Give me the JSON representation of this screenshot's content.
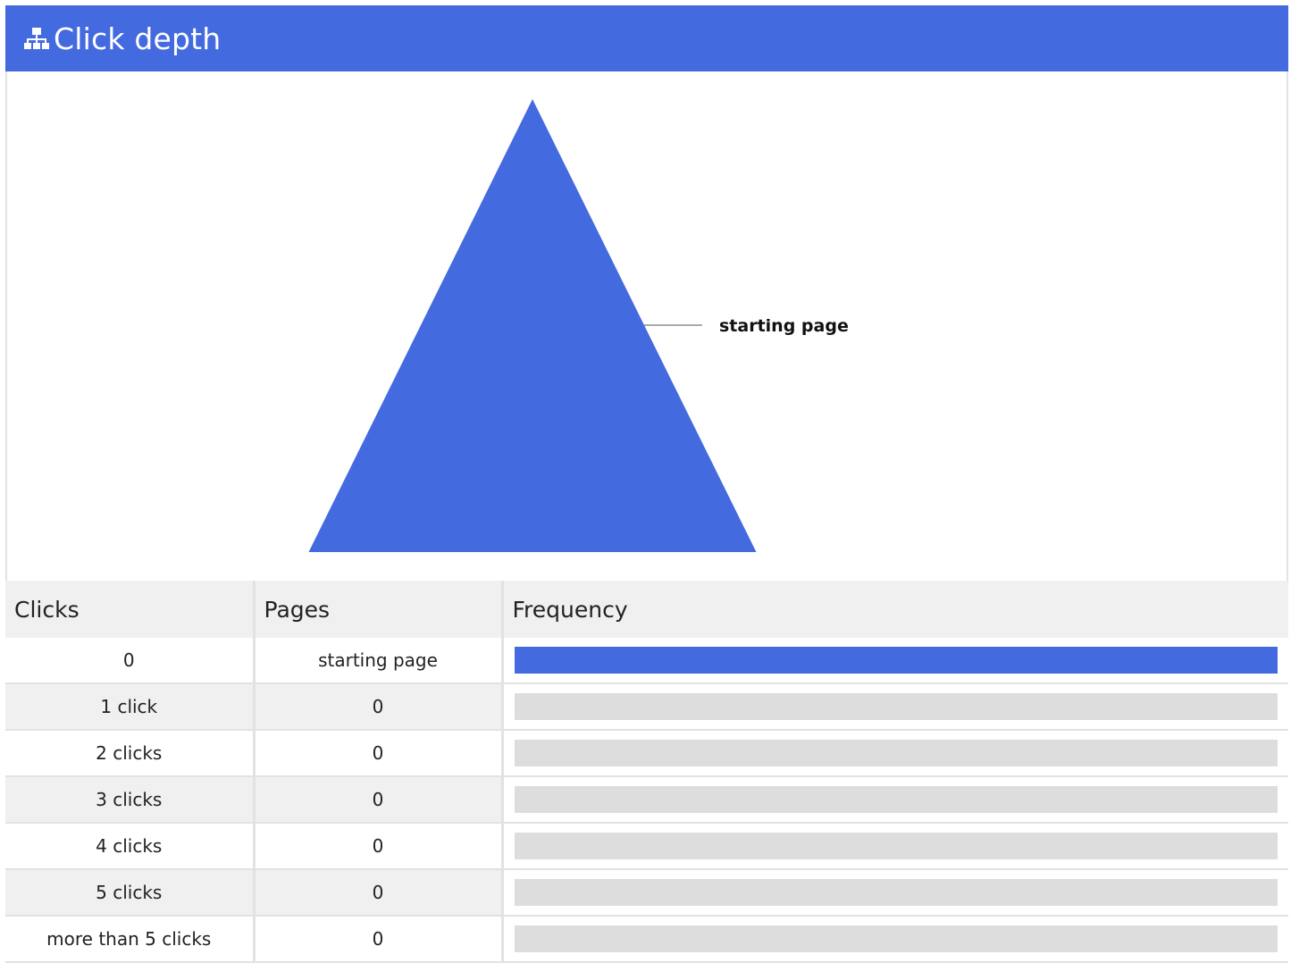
{
  "header": {
    "icon": "sitemap-icon",
    "title": "Click depth"
  },
  "colors": {
    "accent": "#446adf",
    "track": "#dddddd",
    "header_bg": "#f0f0f0"
  },
  "chart_data": {
    "type": "pyramid",
    "segments": [
      {
        "label": "starting page",
        "value": 1
      }
    ]
  },
  "table": {
    "columns": [
      "Clicks",
      "Pages",
      "Frequency"
    ],
    "rows": [
      {
        "clicks": "0",
        "pages": "starting page",
        "frequency": 1.0
      },
      {
        "clicks": "1 click",
        "pages": "0",
        "frequency": 0
      },
      {
        "clicks": "2 clicks",
        "pages": "0",
        "frequency": 0
      },
      {
        "clicks": "3 clicks",
        "pages": "0",
        "frequency": 0
      },
      {
        "clicks": "4 clicks",
        "pages": "0",
        "frequency": 0
      },
      {
        "clicks": "5 clicks",
        "pages": "0",
        "frequency": 0
      },
      {
        "clicks": "more than 5 clicks",
        "pages": "0",
        "frequency": 0
      }
    ]
  }
}
